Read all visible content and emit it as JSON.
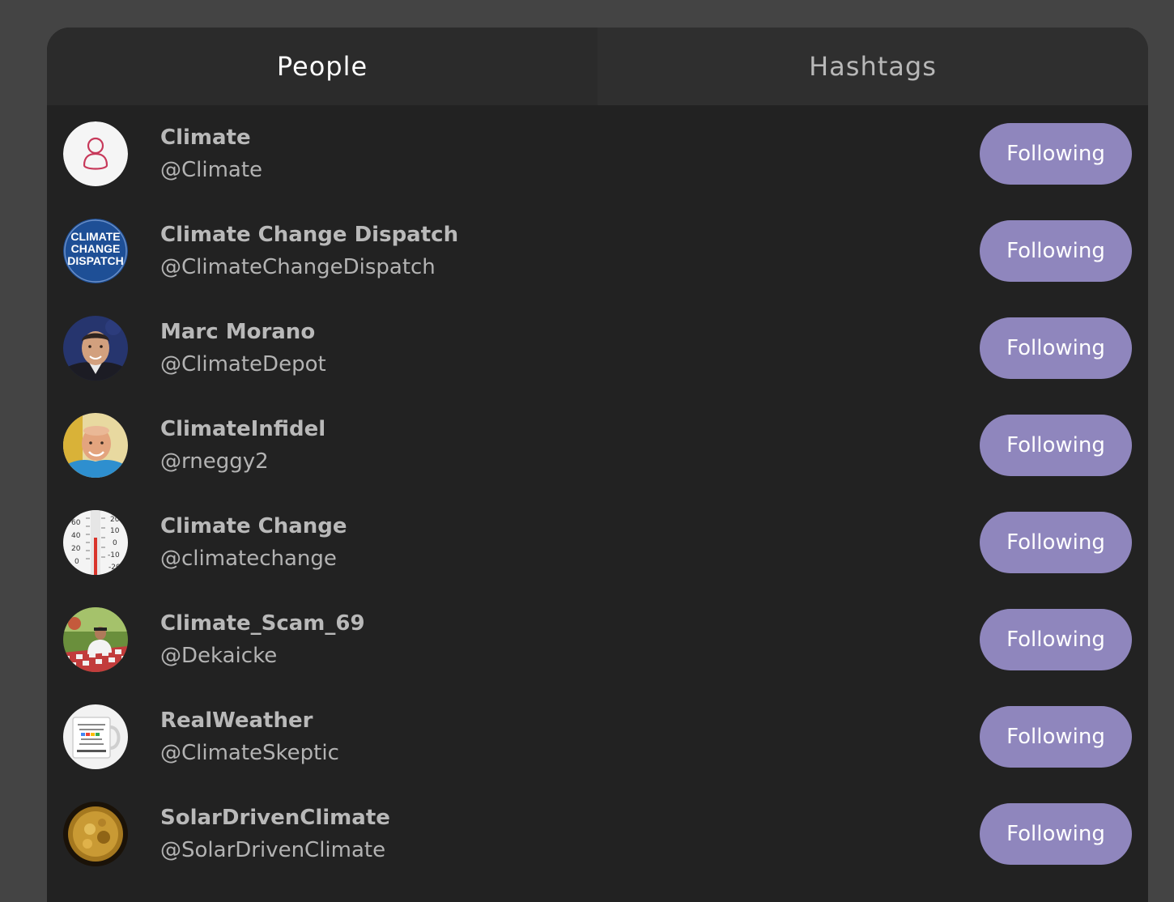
{
  "tabs": [
    {
      "label": "People",
      "active": true
    },
    {
      "label": "Hashtags",
      "active": false
    }
  ],
  "accent_color": "#8f86bd",
  "people": [
    {
      "name": "Climate",
      "handle": "@Climate",
      "button": "Following",
      "avatar": "default-user-icon"
    },
    {
      "name": "Climate Change Dispatch",
      "handle": "@ClimateChangeDispatch",
      "button": "Following",
      "avatar": "logo-avatar",
      "avatar_text": [
        "CLIMATE",
        "CHANGE",
        "DISPATCH"
      ]
    },
    {
      "name": "Marc Morano",
      "handle": "@ClimateDepot",
      "button": "Following",
      "avatar": "photo-avatar"
    },
    {
      "name": "ClimateInfidel",
      "handle": "@rneggy2",
      "button": "Following",
      "avatar": "photo-avatar"
    },
    {
      "name": "Climate Change",
      "handle": "@climatechange",
      "button": "Following",
      "avatar": "thermometer-avatar",
      "avatar_text": [
        "60",
        "40",
        "20",
        "0",
        "20",
        "10",
        "0",
        "-10",
        "-20"
      ]
    },
    {
      "name": "Climate_Scam_69",
      "handle": "@Dekaicke",
      "button": "Following",
      "avatar": "photo-avatar"
    },
    {
      "name": "RealWeather",
      "handle": "@ClimateSkeptic",
      "button": "Following",
      "avatar": "mug-avatar"
    },
    {
      "name": "SolarDrivenClimate",
      "handle": "@SolarDrivenClimate",
      "button": "Following",
      "avatar": "sun-avatar"
    }
  ]
}
